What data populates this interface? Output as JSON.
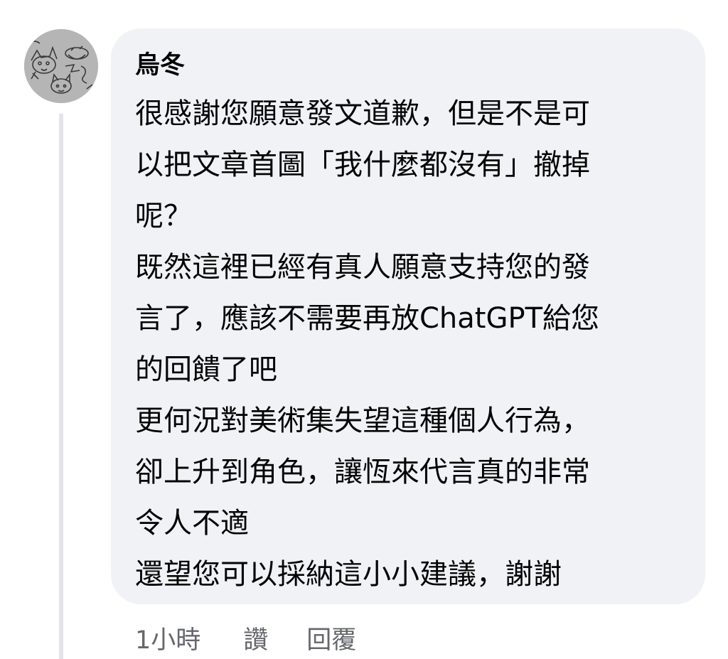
{
  "comment": {
    "author": "烏冬",
    "lines": [
      "很感謝您願意發文道歉，但是不是可",
      "以把文章首圖「我什麼都沒有」撤掉",
      "呢？",
      "既然這裡已經有真人願意支持您的發",
      "言了，應該不需要再放ChatGPT給您",
      "的回饋了吧",
      "更何況對美術集失望這種個人行為，",
      "卻上升到角色，讓恆來代言真的非常",
      "令人不適",
      "還望您可以採納這小小建議，謝謝"
    ]
  },
  "actions": {
    "time": "1小時",
    "like": "讚",
    "reply": "回覆"
  },
  "colors": {
    "bubble_bg": "#f0f2f5",
    "text": "#050505",
    "meta_text": "#65676b",
    "thread_line": "#e3e4e8"
  },
  "icons": {
    "avatar": "doodle-cat-avatar"
  }
}
